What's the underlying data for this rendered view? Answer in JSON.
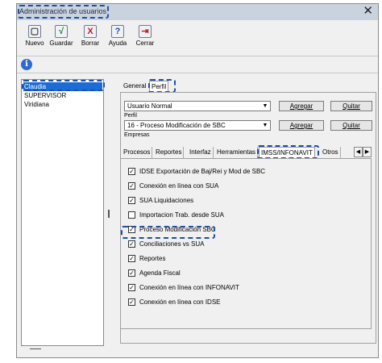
{
  "window": {
    "title": "Administración de usuarios",
    "close_glyph": "✕"
  },
  "toolbar": {
    "buttons": [
      {
        "label": "Nuevo",
        "icon": "new-document-icon",
        "glyph": "▢"
      },
      {
        "label": "Guardar",
        "icon": "checkmark-icon",
        "glyph": "√"
      },
      {
        "label": "Borrar",
        "icon": "delete-x-icon",
        "glyph": "X"
      },
      {
        "label": "Ayuda",
        "icon": "help-icon",
        "glyph": "?"
      },
      {
        "label": "Cerrar",
        "icon": "exit-door-icon",
        "glyph": "⇥"
      }
    ]
  },
  "info_icon": {
    "glyph": "i",
    "color": "#2c6bd4"
  },
  "users": [
    "Claudia",
    "SUPERVISOR",
    "Viridiana"
  ],
  "selected_user": "Claudia",
  "top_tabs": [
    "General",
    "Perfil"
  ],
  "active_top_tab": "Perfil",
  "profile": {
    "type_value": "Usuario Normal",
    "perfil_label": "Perfil",
    "perfil_value": "16 - Proceso Modificación de SBC",
    "empresas_label": "Empresas",
    "agregar_label": "Agregar",
    "quitar_label": "Quitar"
  },
  "inner_tabs": [
    "Procesos",
    "Reportes",
    "Interfaz",
    "Herramientas",
    "IMSS/INFONAVIT",
    "Otros"
  ],
  "active_inner_tab": "IMSS/INFONAVIT",
  "permissions": [
    {
      "label": "IDSE Exportación de Baj/Rei y Mod de SBC",
      "checked": true
    },
    {
      "label": "Conexión en línea con SUA",
      "checked": true
    },
    {
      "label": "SUA Liquidaciones",
      "checked": true
    },
    {
      "label": "Importacion Trab. desde SUA",
      "checked": false
    },
    {
      "label": "Proceso Modificación SBC",
      "checked": true
    },
    {
      "label": "Conciliaciones vs SUA",
      "checked": true
    },
    {
      "label": "Reportes",
      "checked": true
    },
    {
      "label": "Agenda Fiscal",
      "checked": true
    },
    {
      "label": "Conexión en línea con INFONAVIT",
      "checked": true
    },
    {
      "label": "Conexión en línea con IDSE",
      "checked": true
    }
  ],
  "colors": {
    "selection": "#1c6cd6",
    "highlight": "#1f4fa3",
    "titlebar": "#c9d3df"
  }
}
